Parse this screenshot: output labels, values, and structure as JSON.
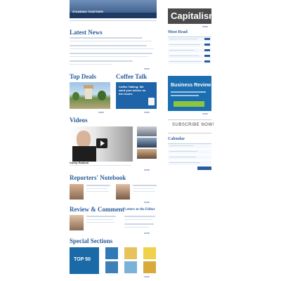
{
  "banner": {
    "caption": "STANDING TOGETHER"
  },
  "logo": {
    "text": "Capitalism"
  },
  "headings": {
    "latest_news": "Latest News",
    "top_deals": "Top Deals",
    "coffee_talk": "Coffee Talk",
    "videos": "Videos",
    "reporters_notebook": "Reporters' Notebook",
    "review_comment": "Review & Comment",
    "letters": "Letters to the Editor",
    "special_sections": "Special Sections",
    "most_read": "Most Read",
    "calendar": "Calendar"
  },
  "coffee_talk": {
    "promo": "Coffee Talking: We want your advice on the issues"
  },
  "ad": {
    "title": "Business Review"
  },
  "subscribe": {
    "label": "SUBSCRIBE NOW!"
  },
  "video": {
    "caption": "Corey Hudson"
  },
  "special": {
    "badge": "TOP 50"
  },
  "colors": {
    "accent": "#2a5c9a",
    "light_blue": "#e8f0f8",
    "ad_bg": "#1b6eb0"
  }
}
